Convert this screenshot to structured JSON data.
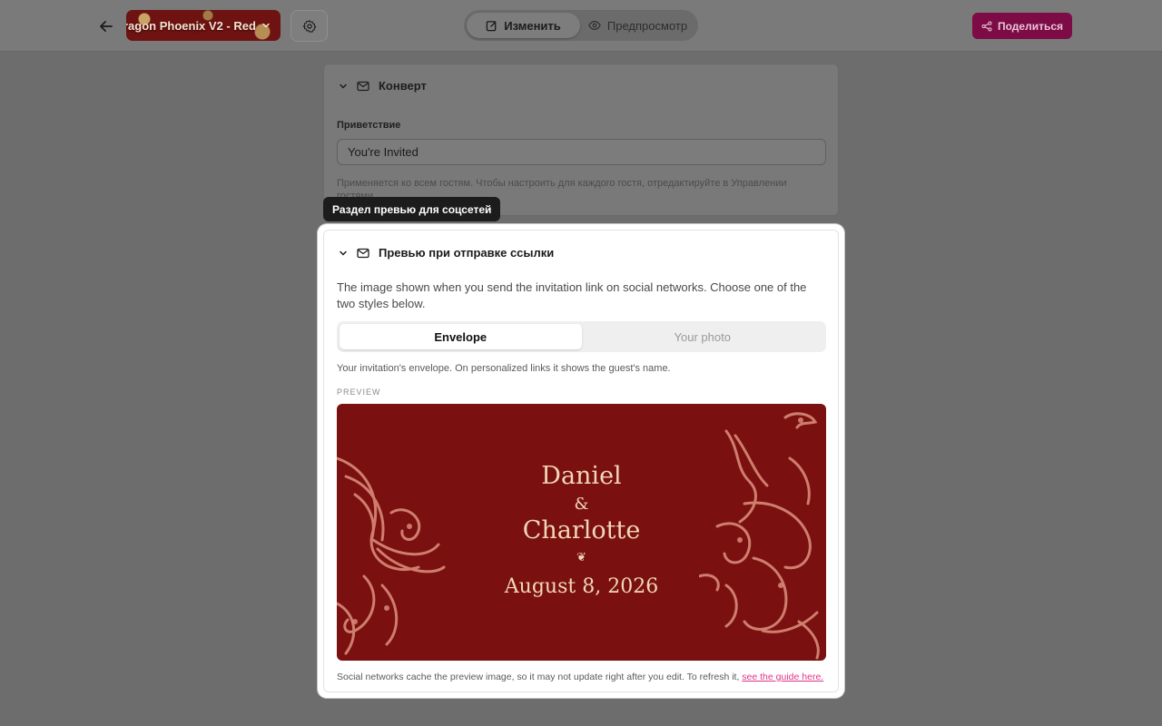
{
  "header": {
    "back_icon": "arrow-left-icon",
    "theme_name": "ragon Phoenix V2 - Red",
    "settings_icon": "gear-icon",
    "mode_edit_label": "Изменить",
    "mode_preview_label": "Предпросмотр",
    "share_label": "Поделиться",
    "accent_color": "#c2185b"
  },
  "envelope_section": {
    "title": "Конверт",
    "greeting_label": "Приветствие",
    "greeting_value": "You're Invited",
    "help_text": "Применяется ко всем гостям. Чтобы настроить для каждого гостя, отредактируйте в Управлении гостями."
  },
  "tooltip": "Раздел превью для соцсетей",
  "social_section": {
    "title": "Превью при отправке ссылки",
    "description": "The image shown when you send the invitation link on social networks. Choose one of the two styles below.",
    "options": [
      "Envelope",
      "Your photo"
    ],
    "selected": "Envelope",
    "envelope_note": "Your invitation's envelope. On personalized links it shows the guest's name.",
    "preview_label": "PREVIEW",
    "preview": {
      "name1": "Daniel",
      "amp": "&",
      "name2": "Charlotte",
      "fleur": "❦",
      "date": "August 8, 2026",
      "bg_color": "#7a1010",
      "text_color": "#f1d7b8"
    },
    "footer_text": "Social networks cache the preview image, so it may not update right after you edit. To refresh it,",
    "footer_link": "see the guide here."
  }
}
